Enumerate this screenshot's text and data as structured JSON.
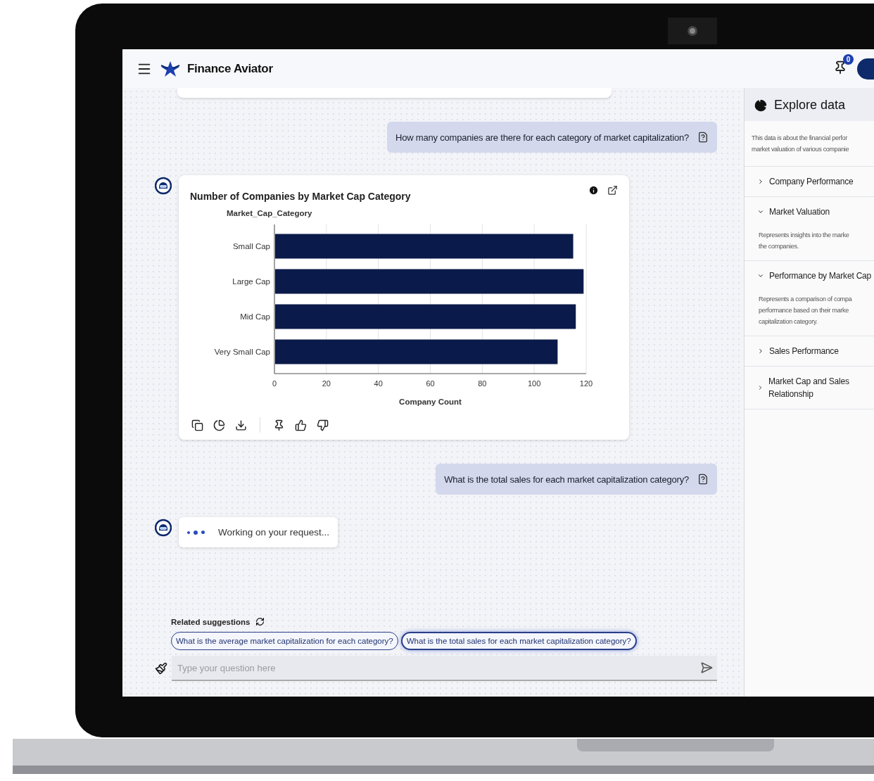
{
  "header": {
    "title": "Finance Aviator",
    "pin_badge": "0"
  },
  "messages": [
    {
      "kind": "user",
      "text": "How many companies are there for each category of market capitalization?"
    },
    {
      "kind": "chart",
      "chart_data": {
        "type": "bar",
        "orientation": "horizontal",
        "title": "Number of Companies by Market Cap Category",
        "ylabel": "Market_Cap_Category",
        "xlabel": "Company Count",
        "categories": [
          "Small Cap",
          "Large Cap",
          "Mid Cap",
          "Very Small Cap"
        ],
        "values": [
          115,
          119,
          116,
          109
        ],
        "xlim": [
          0,
          120
        ],
        "xticks": [
          0,
          20,
          40,
          60,
          80,
          100,
          120
        ],
        "grid": true
      }
    },
    {
      "kind": "user",
      "text": "What is the total sales for each market capitalization category?"
    },
    {
      "kind": "working",
      "text": "Working on your request..."
    }
  ],
  "suggestions": {
    "label": "Related suggestions",
    "items": [
      {
        "text": "What is the average market capitalization for each category?",
        "selected": false
      },
      {
        "text": "What is the total sales for each market capitalization category?",
        "selected": true
      }
    ]
  },
  "input": {
    "placeholder": "Type your question here"
  },
  "explore": {
    "title": "Explore data",
    "description": [
      "This data is about the financial perfor",
      "market valuation of various companie"
    ],
    "items": [
      {
        "label": "Company Performance",
        "expanded": false
      },
      {
        "label": "Market Valuation",
        "expanded": true,
        "description": [
          "Represents insights into the marke",
          "the companies."
        ]
      },
      {
        "label": "Performance by Market Cap",
        "expanded": true,
        "description": [
          "Represents a comparison of compa",
          "performance based on their marke",
          "capitalization category."
        ]
      },
      {
        "label": "Sales Performance",
        "expanded": false
      },
      {
        "label": "Market Cap and Sales Relationship",
        "expanded": false
      }
    ]
  }
}
